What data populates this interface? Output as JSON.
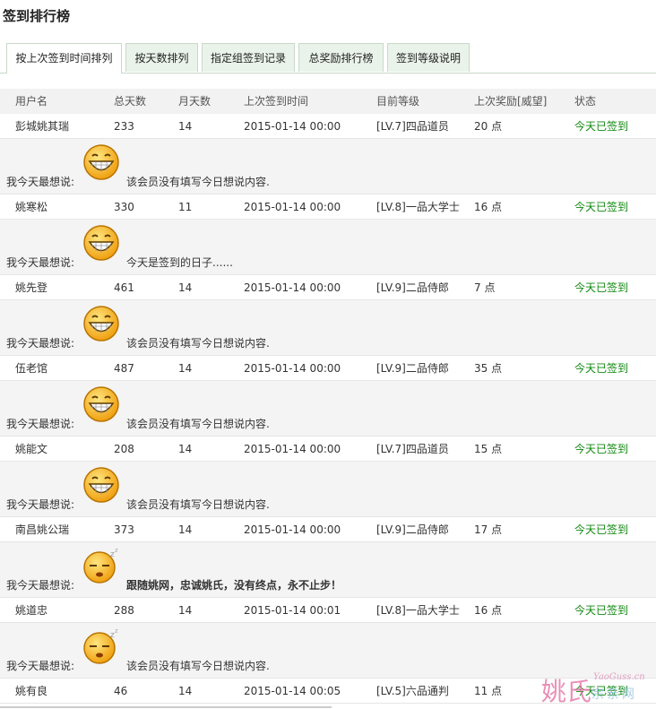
{
  "page": {
    "title": "签到排行榜"
  },
  "tabs": [
    {
      "label": "按上次签到时间排列",
      "active": true
    },
    {
      "label": "按天数排列",
      "active": false
    },
    {
      "label": "指定组签到记录",
      "active": false
    },
    {
      "label": "总奖励排行榜",
      "active": false
    },
    {
      "label": "签到等级说明",
      "active": false
    }
  ],
  "table": {
    "headers": [
      "用户名",
      "总天数",
      "月天数",
      "上次签到时间",
      "目前等级",
      "上次奖励[威望]",
      "状态"
    ],
    "message_label": "我今天最想说:",
    "rows": [
      {
        "user": "彭城姚其瑞",
        "total_days": "233",
        "month_days": "14",
        "last_time": "2015-01-14 00:00",
        "level": "[LV.7]四品道员",
        "reward": "20 点",
        "status": "今天已签到",
        "emoji": "grin-icon",
        "message": "该会员没有填写今日想说内容."
      },
      {
        "user": "姚寒松",
        "total_days": "330",
        "month_days": "11",
        "last_time": "2015-01-14 00:00",
        "level": "[LV.8]一品大学士",
        "reward": "16 点",
        "status": "今天已签到",
        "emoji": "grin-icon",
        "message": "今天是签到的日子......"
      },
      {
        "user": "姚先登",
        "total_days": "461",
        "month_days": "14",
        "last_time": "2015-01-14 00:00",
        "level": "[LV.9]二品侍郎",
        "reward": "7 点",
        "status": "今天已签到",
        "emoji": "grin-icon",
        "message": "该会员没有填写今日想说内容."
      },
      {
        "user": "伍老馆",
        "total_days": "487",
        "month_days": "14",
        "last_time": "2015-01-14 00:00",
        "level": "[LV.9]二品侍郎",
        "reward": "35 点",
        "status": "今天已签到",
        "emoji": "grin-icon",
        "message": "该会员没有填写今日想说内容."
      },
      {
        "user": "姚能文",
        "total_days": "208",
        "month_days": "14",
        "last_time": "2015-01-14 00:00",
        "level": "[LV.7]四品道员",
        "reward": "15 点",
        "status": "今天已签到",
        "emoji": "grin-icon",
        "message": "该会员没有填写今日想说内容."
      },
      {
        "user": "南昌姚公瑞",
        "total_days": "373",
        "month_days": "14",
        "last_time": "2015-01-14 00:00",
        "level": "[LV.9]二品侍郎",
        "reward": "17 点",
        "status": "今天已签到",
        "emoji": "sleepy-icon",
        "message": "跟随姚网，忠诚姚氏，没有终点，永不止步！"
      },
      {
        "user": "姚道忠",
        "total_days": "288",
        "month_days": "14",
        "last_time": "2015-01-14 00:01",
        "level": "[LV.8]一品大学士",
        "reward": "16 点",
        "status": "今天已签到",
        "emoji": "sleepy-icon",
        "message": "该会员没有填写今日想说内容."
      },
      {
        "user": "姚有良",
        "total_days": "46",
        "month_days": "14",
        "last_time": "2015-01-14 00:05",
        "level": "[LV.5]六品通判",
        "reward": "11 点",
        "status": "今天已签到"
      }
    ]
  },
  "watermark": {
    "name": "姚氏",
    "url": "YaoGuss.cn",
    "sub": "宗亲网"
  },
  "colors": {
    "status": "#118811",
    "tab_bg": "#eaf3ea",
    "tab_border": "#c9d8c9",
    "watermark": "#e26aa0"
  }
}
